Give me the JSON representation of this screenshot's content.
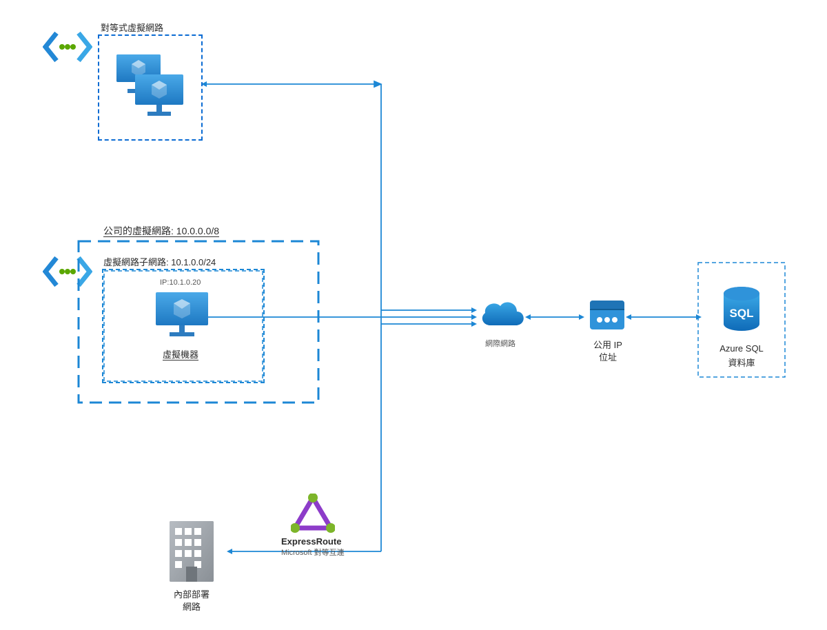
{
  "colors": {
    "azure_blue": "#2388d6",
    "azure_dark": "#0f5ba8",
    "line": "#1c87d5",
    "green": "#5aa700",
    "gray": "#9aa0a6",
    "purple": "#8d3cc9"
  },
  "nodes": {
    "peered_vnet": {
      "title": "對等式虛擬網路"
    },
    "corp_vnet_title": "公司的虛擬網路: 10.0.0.0/8",
    "subnet_title": "虛擬網路子網路: 10.1.0.0/24",
    "vm_ip": "IP:10.1.0.20",
    "vm_label": "虛擬機器",
    "internet_label": "網際網路",
    "public_ip_label1": "公用 IP",
    "public_ip_label2": "位址",
    "sql_label1": "Azure SQL",
    "sql_label2": "資料庫",
    "expressroute_label1": "ExpressRoute",
    "expressroute_label2": "Microsoft 對等互連",
    "onprem_label1": "內部部署",
    "onprem_label2": "網路"
  }
}
